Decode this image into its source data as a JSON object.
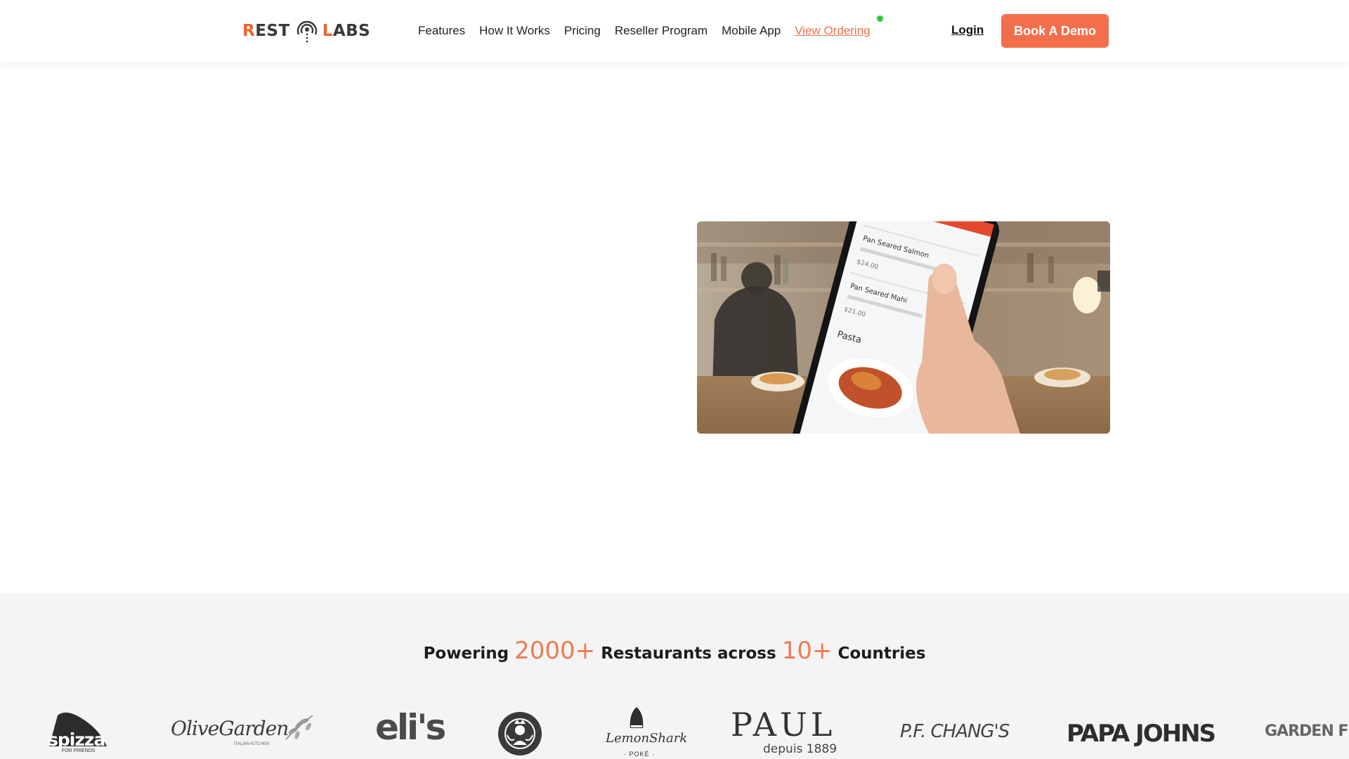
{
  "header": {
    "logo": {
      "part1_accent": "R",
      "part1": "EST",
      "part2_accent": "L",
      "part2": "ABS"
    },
    "nav": [
      {
        "label": "Features"
      },
      {
        "label": "How It Works"
      },
      {
        "label": "Pricing"
      },
      {
        "label": "Reseller Program"
      },
      {
        "label": "Mobile App"
      },
      {
        "label": "View Ordering"
      }
    ],
    "login_label": "Login",
    "demo_label": "Book A Demo"
  },
  "hero": {
    "phone_items": [
      {
        "name": "Pan Seared Salmon",
        "price": "$24.00"
      },
      {
        "name": "Pan Seared Mahi",
        "price": "$21.00"
      }
    ],
    "phone_section": "Pasta"
  },
  "stats": {
    "prefix": "Powering",
    "restaurants": "2000+",
    "middle": "Restaurants across",
    "countries": "10+",
    "suffix": "Countries"
  },
  "brands": {
    "spizza": "spizza",
    "spizza_sub": "FOR FRIENDS",
    "olive_garden": "OliveGarden",
    "olive_garden_sub": "ITALIAN KITCHEN",
    "elis": "eli's",
    "lemon_shark": "LemonShark",
    "lemon_shark_sub": "· POKÉ ·",
    "paul": "PAUL",
    "paul_sub": "depuis 1889",
    "pf_changs": "P.F. CHANG'S",
    "papa_johns": "PAPA JOHNS",
    "garden_fresh": "GARDEN FR"
  },
  "colors": {
    "accent": "#f36f4b",
    "live_dot": "#2ecc40",
    "strip_bg": "#f4f4f4"
  }
}
